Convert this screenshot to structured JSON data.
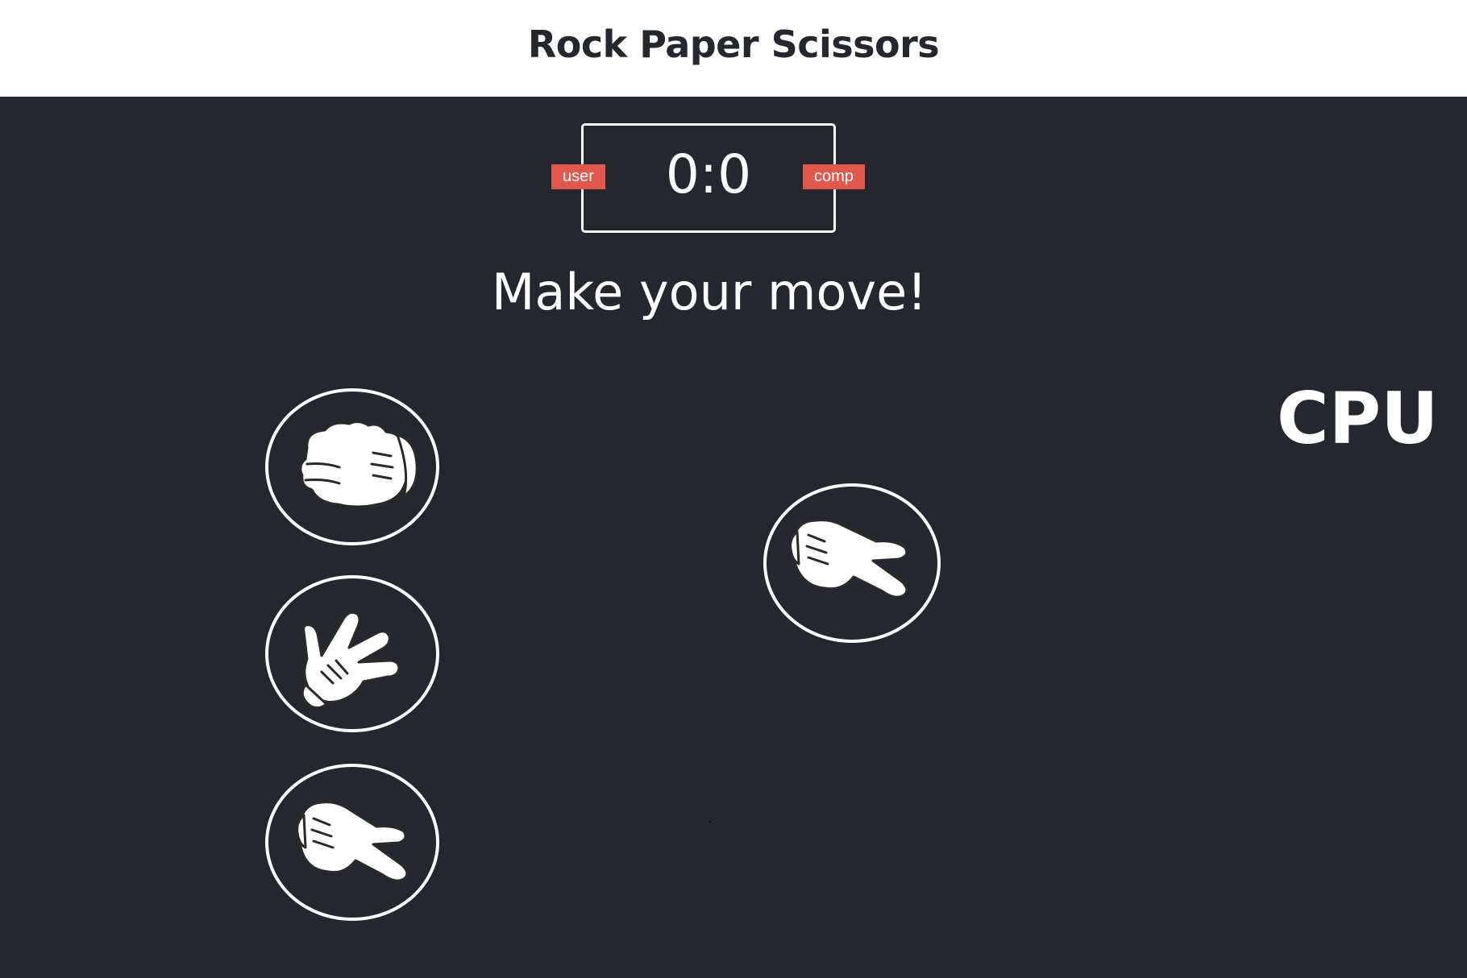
{
  "header": {
    "title": "Rock Paper Scissors"
  },
  "scoreboard": {
    "score": "0:0",
    "user_label": "user",
    "comp_label": "comp"
  },
  "message": "Make your move!",
  "cpu_label": "CPU",
  "choices": [
    {
      "id": "rock",
      "icon": "rock-hand-icon"
    },
    {
      "id": "paper",
      "icon": "paper-hand-icon"
    },
    {
      "id": "scissors",
      "icon": "scissors-hand-icon"
    }
  ],
  "cpu_choice": {
    "id": "scissors",
    "icon": "scissors-hand-icon"
  },
  "colors": {
    "background": "#24272e",
    "header_background": "#ffffff",
    "badge": "#e2584d",
    "foreground": "#ffffff"
  }
}
